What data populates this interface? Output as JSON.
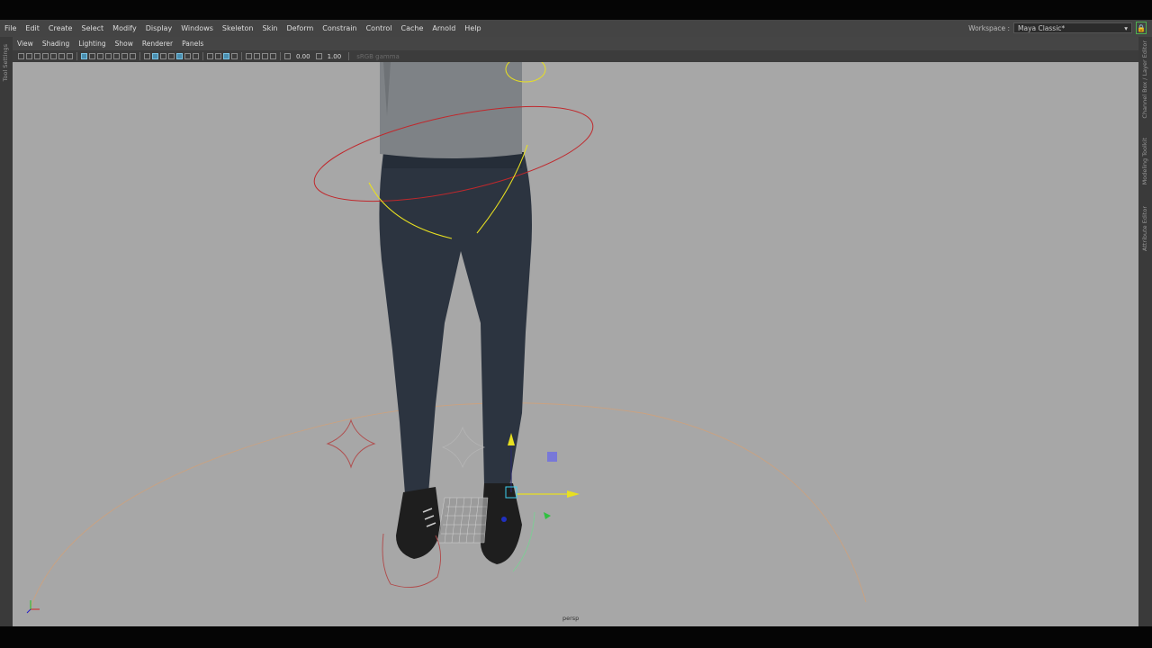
{
  "menubar": {
    "items": [
      "File",
      "Edit",
      "Create",
      "Select",
      "Modify",
      "Display",
      "Windows",
      "Skeleton",
      "Skin",
      "Deform",
      "Constrain",
      "Control",
      "Cache",
      "Arnold",
      "Help"
    ]
  },
  "workspace": {
    "label": "Workspace :",
    "value": "Maya Classic*"
  },
  "left_strip": {
    "label": "Tool Settings"
  },
  "right_strip": {
    "labels": [
      "Channel Box / Layer Editor",
      "Modeling Toolkit",
      "Attribute Editor"
    ]
  },
  "panel_menu": {
    "items": [
      "View",
      "Shading",
      "Lighting",
      "Show",
      "Renderer",
      "Panels"
    ]
  },
  "toolbar": {
    "near_value": "0.00",
    "far_value": "1.00",
    "color_space": "sRGB gamma"
  },
  "viewport": {
    "camera_label": "persp",
    "background": "#a7a7a7"
  }
}
